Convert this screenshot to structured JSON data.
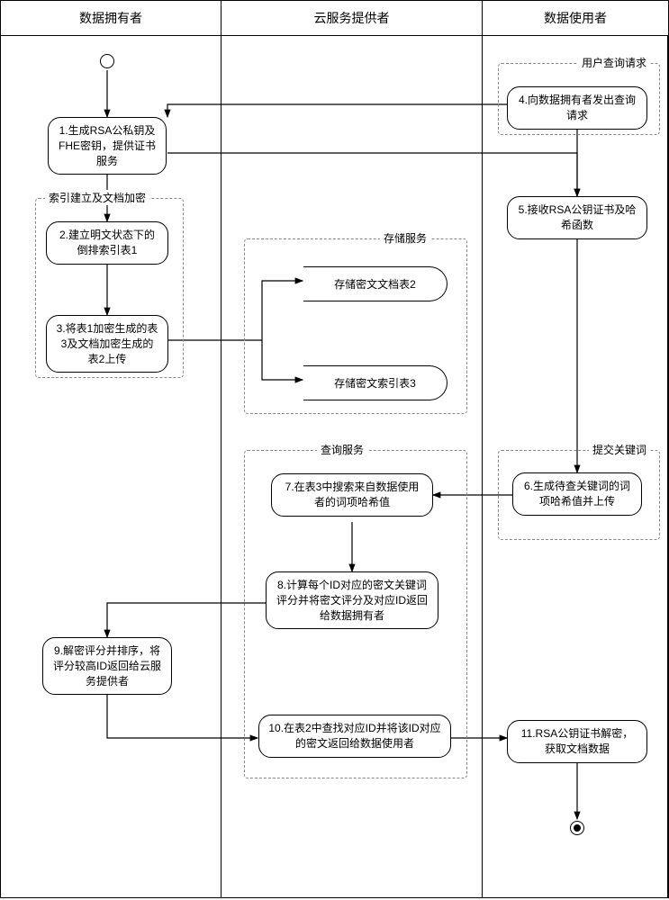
{
  "chart_data": {
    "type": "diagram",
    "subtype": "swimlane-activity-diagram",
    "lanes": [
      "数据拥有者",
      "云服务提供者",
      "数据使用者"
    ],
    "nodes": [
      {
        "id": "start",
        "type": "start",
        "lane": 0
      },
      {
        "id": "n1",
        "lane": 0,
        "text": "1.生成RSA公私钥及FHE密钥，提供证书服务"
      },
      {
        "id": "n2",
        "lane": 0,
        "text": "2.建立明文状态下的倒排索引表1"
      },
      {
        "id": "n3",
        "lane": 0,
        "text": "3.将表1加密生成的表3及文档加密生成的表2上传"
      },
      {
        "id": "ds1",
        "lane": 1,
        "type": "datastore",
        "text": "存储密文文档表2"
      },
      {
        "id": "ds2",
        "lane": 1,
        "type": "datastore",
        "text": "存储密文索引表3"
      },
      {
        "id": "n4",
        "lane": 2,
        "text": "4.向数据拥有者发出查询请求"
      },
      {
        "id": "n5",
        "lane": 2,
        "text": "5.接收RSA公钥证书及哈希函数"
      },
      {
        "id": "n6",
        "lane": 2,
        "text": "6.生成待查关键词的词项哈希值并上传"
      },
      {
        "id": "n7",
        "lane": 1,
        "text": "7.在表3中搜索来自数据使用者的词项哈希值"
      },
      {
        "id": "n8",
        "lane": 1,
        "text": "8.计算每个ID对应的密文关键词评分并将密文评分及对应ID返回给数据拥有者"
      },
      {
        "id": "n9",
        "lane": 0,
        "text": "9.解密评分并排序，将评分较高ID返回给云服务提供者"
      },
      {
        "id": "n10",
        "lane": 1,
        "text": "10.在表2中查找对应ID并将该ID对应的密文返回给数据使用者"
      },
      {
        "id": "n11",
        "lane": 2,
        "text": "11.RSA公钥证书解密，获取文档数据"
      },
      {
        "id": "end",
        "type": "end",
        "lane": 2
      }
    ],
    "groups": [
      {
        "label": "用户查询请求",
        "contains": [
          "n4"
        ]
      },
      {
        "label": "索引建立及文档加密",
        "contains": [
          "n2",
          "n3"
        ]
      },
      {
        "label": "存储服务",
        "contains": [
          "ds1",
          "ds2"
        ]
      },
      {
        "label": "查询服务",
        "contains": [
          "n7",
          "n8",
          "n10"
        ]
      },
      {
        "label": "提交关键词",
        "contains": [
          "n6"
        ]
      }
    ],
    "edges": [
      [
        "start",
        "n1"
      ],
      [
        "n4",
        "n1"
      ],
      [
        "n1",
        "n2"
      ],
      [
        "n1",
        "n5"
      ],
      [
        "n2",
        "n3"
      ],
      [
        "n3",
        "ds1"
      ],
      [
        "n3",
        "ds2"
      ],
      [
        "n4",
        "n5"
      ],
      [
        "n5",
        "n6"
      ],
      [
        "n6",
        "n7"
      ],
      [
        "n7",
        "n8"
      ],
      [
        "n8",
        "n9"
      ],
      [
        "n9",
        "n10"
      ],
      [
        "n10",
        "n11"
      ],
      [
        "n11",
        "end"
      ]
    ]
  },
  "lanes": {
    "owner": "数据拥有者",
    "cloud": "云服务提供者",
    "user": "数据使用者"
  },
  "nodes": {
    "n1": "1.生成RSA公私钥及FHE密钥，提供证书服务",
    "n2": "2.建立明文状态下的倒排索引表1",
    "n3": "3.将表1加密生成的表3及文档加密生成的表2上传",
    "ds1": "存储密文文档表2",
    "ds2": "存储密文索引表3",
    "n4": "4.向数据拥有者发出查询请求",
    "n5": "5.接收RSA公钥证书及哈希函数",
    "n6": "6.生成待查关键词的词项哈希值并上传",
    "n7": "7.在表3中搜索来自数据使用者的词项哈希值",
    "n8": "8.计算每个ID对应的密文关键词评分并将密文评分及对应ID返回给数据拥有者",
    "n9": "9.解密评分并排序，将评分较高ID返回给云服务提供者",
    "n10": "10.在表2中查找对应ID并将该ID对应的密文返回给数据使用者",
    "n11": "11.RSA公钥证书解密，获取文档数据"
  },
  "groups": {
    "g1": "用户查询请求",
    "g2": "索引建立及文档加密",
    "g3": "存储服务",
    "g4": "查询服务",
    "g5": "提交关键词"
  }
}
